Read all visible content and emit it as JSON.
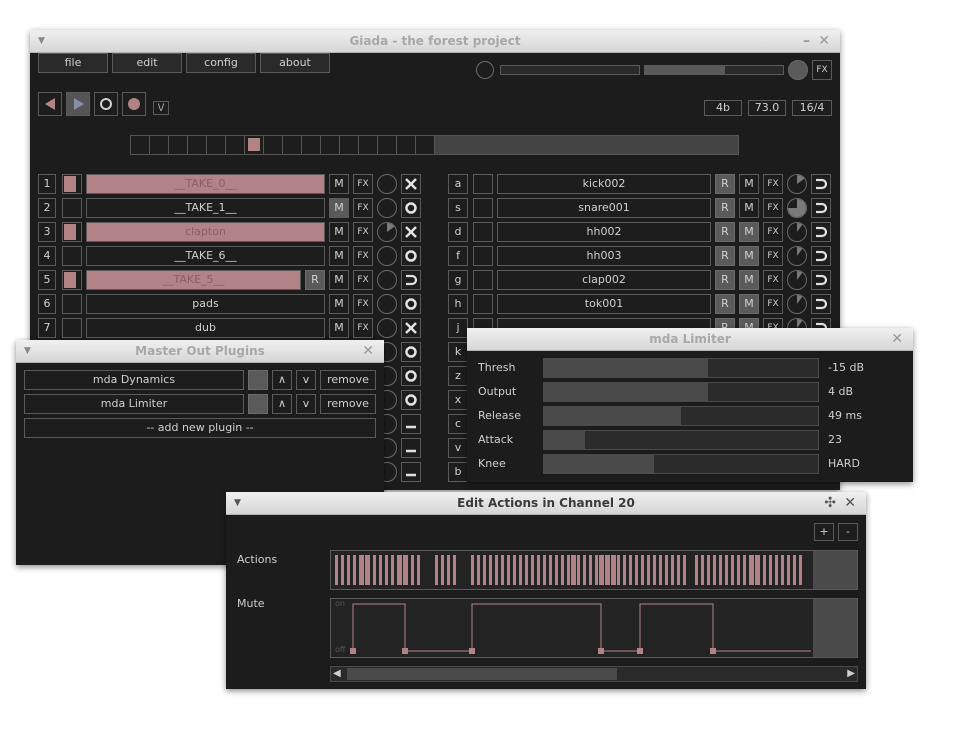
{
  "main_window": {
    "title": "Giada - the forest project",
    "menu": [
      "file",
      "edit",
      "config",
      "about"
    ],
    "fx_label": "FX",
    "beats": "4b",
    "bpm": "73.0",
    "meter": "16/4",
    "input_meter_level": 0,
    "output_meter_level": 0.58,
    "rec_toggle_label": "\\/"
  },
  "left_channels": [
    {
      "index": "1",
      "name": "__TAKE_0__",
      "highlight": true,
      "rec": false,
      "status": "x-icon",
      "pct": 0
    },
    {
      "index": "2",
      "name": "__TAKE_1__",
      "highlight": false,
      "rec": false,
      "status": "o-icon",
      "pct": 0
    },
    {
      "index": "3",
      "name": "clapton",
      "highlight": true,
      "rec": false,
      "status": "x-icon",
      "pct": 0.15
    },
    {
      "index": "4",
      "name": "__TAKE_6__",
      "highlight": false,
      "rec": false,
      "status": "o-icon",
      "pct": 0
    },
    {
      "index": "5",
      "name": "__TAKE_5__",
      "highlight": true,
      "rec": true,
      "status": "loop-icon",
      "pct": 0
    },
    {
      "index": "6",
      "name": "pads",
      "highlight": false,
      "rec": false,
      "status": "o-icon",
      "pct": 0
    },
    {
      "index": "7",
      "name": "dub",
      "highlight": false,
      "rec": false,
      "status": "x-icon",
      "pct": 0
    }
  ],
  "right_channels": [
    {
      "key": "a",
      "name": "kick002",
      "mute_on": false,
      "status": "loop-icon",
      "pct": 0.15
    },
    {
      "key": "s",
      "name": "snare001",
      "mute_on": false,
      "status": "loop-icon",
      "pct": 0.75
    },
    {
      "key": "d",
      "name": "hh002",
      "mute_on": true,
      "status": "loop-icon",
      "pct": 0.1
    },
    {
      "key": "f",
      "name": "hh003",
      "mute_on": true,
      "status": "loop-icon",
      "pct": 0.1
    },
    {
      "key": "g",
      "name": "clap002",
      "mute_on": true,
      "status": "loop-icon",
      "pct": 0.1
    },
    {
      "key": "h",
      "name": "tok001",
      "mute_on": true,
      "status": "loop-icon",
      "pct": 0.1
    },
    {
      "key": "j",
      "name": "",
      "mute_on": true,
      "status": "loop-icon",
      "pct": 0.1
    }
  ],
  "partial_keys": [
    "k",
    "z",
    "x",
    "c",
    "v",
    "b"
  ],
  "master_plugins": {
    "title": "Master Out Plugins",
    "plugins": [
      {
        "name": "mda Dynamics",
        "up": "∧",
        "down": "v",
        "remove": "remove"
      },
      {
        "name": "mda Limiter",
        "up": "∧",
        "down": "v",
        "remove": "remove"
      }
    ],
    "add_label": "-- add new plugin --"
  },
  "limiter": {
    "title": "mda Limiter",
    "params": [
      {
        "label": "Thresh",
        "value": "-15 dB",
        "fill": 0.6
      },
      {
        "label": "Output",
        "value": "4 dB",
        "fill": 0.6
      },
      {
        "label": "Release",
        "value": "49 ms",
        "fill": 0.5
      },
      {
        "label": "Attack",
        "value": "23",
        "fill": 0.15
      },
      {
        "label": "Knee",
        "value": "HARD",
        "fill": 0.4
      }
    ]
  },
  "actions": {
    "title": "Edit Actions in Channel 20",
    "plus": "+",
    "minus": "-",
    "actions_label": "Actions",
    "mute_label": "Mute",
    "on_label": "on",
    "off_label": "off"
  },
  "colors": {
    "pink": "#b28386",
    "panel": "#1c1c1c",
    "border": "#5a5a5a",
    "text": "#cfcfcf"
  }
}
